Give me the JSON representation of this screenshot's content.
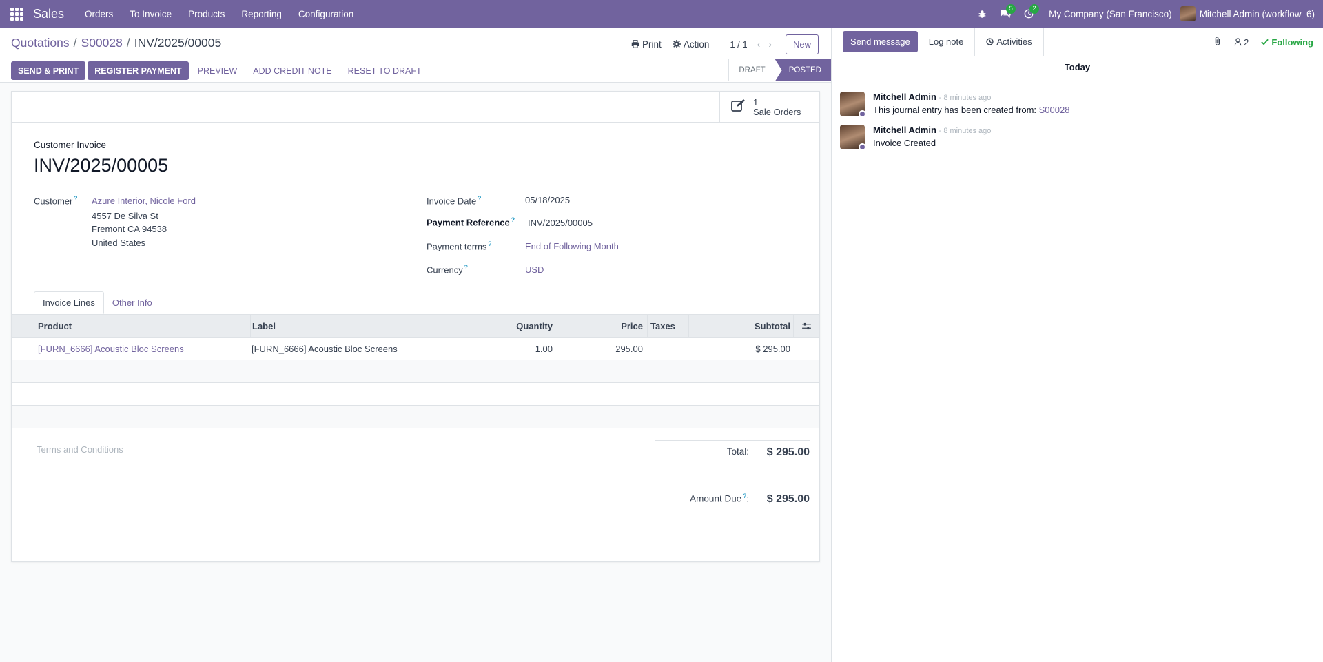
{
  "navbar": {
    "brand": "Sales",
    "menu": [
      "Orders",
      "To Invoice",
      "Products",
      "Reporting",
      "Configuration"
    ],
    "messages_badge": "5",
    "activities_badge": "2",
    "company": "My Company (San Francisco)",
    "user": "Mitchell Admin (workflow_6)"
  },
  "breadcrumb": {
    "items": [
      "Quotations",
      "S00028"
    ],
    "current": "INV/2025/00005"
  },
  "control": {
    "print_label": "Print",
    "action_label": "Action",
    "pager": "1 / 1",
    "new_label": "New"
  },
  "statusbar": {
    "send_print": "SEND & PRINT",
    "register_payment": "REGISTER PAYMENT",
    "preview": "PREVIEW",
    "add_credit_note": "ADD CREDIT NOTE",
    "reset_to_draft": "RESET TO DRAFT",
    "stage_draft": "DRAFT",
    "stage_posted": "POSTED"
  },
  "smart_button": {
    "count": "1",
    "label": "Sale Orders"
  },
  "invoice": {
    "type": "Customer Invoice",
    "number": "INV/2025/00005",
    "customer_label": "Customer",
    "customer_name": "Azure Interior, Nicole Ford",
    "address_line1": "4557 De Silva St",
    "address_line2": "Fremont CA 94538",
    "address_line3": "United States",
    "invoice_date_label": "Invoice Date",
    "invoice_date": "05/18/2025",
    "payment_reference_label": "Payment Reference",
    "payment_reference": "INV/2025/00005",
    "payment_terms_label": "Payment terms",
    "payment_terms": "End of Following Month",
    "currency_label": "Currency",
    "currency": "USD"
  },
  "tabs": [
    "Invoice Lines",
    "Other Info"
  ],
  "lines": {
    "headers": [
      "Product",
      "Label",
      "Quantity",
      "Price",
      "Taxes",
      "Subtotal"
    ],
    "rows": [
      {
        "product": "[FURN_6666] Acoustic Bloc Screens",
        "label": "[FURN_6666] Acoustic Bloc Screens",
        "quantity": "1.00",
        "price": "295.00",
        "taxes": "",
        "subtotal": "$ 295.00"
      }
    ]
  },
  "totals": {
    "terms_placeholder": "Terms and Conditions",
    "total_label": "Total:",
    "total_value": "$ 295.00",
    "amount_due_label": "Amount Due",
    "amount_due_colon": ":",
    "amount_due_value": "$ 295.00"
  },
  "chatter": {
    "send_message": "Send message",
    "log_note": "Log note",
    "activities": "Activities",
    "followers_count": "2",
    "following": "Following",
    "today": "Today",
    "messages": [
      {
        "author": "Mitchell Admin",
        "time": "- 8 minutes ago",
        "text": "This journal entry has been created from: ",
        "link": "S00028"
      },
      {
        "author": "Mitchell Admin",
        "time": "- 8 minutes ago",
        "text": "Invoice Created",
        "link": ""
      }
    ]
  },
  "colors": {
    "brand": "#71639e",
    "badge": "#28a745",
    "following": "#28a745"
  },
  "icons": [
    "apps-grid-icon",
    "bug-icon",
    "chat-icon",
    "clock-icon",
    "print-icon",
    "gear-icon",
    "chevron-left-icon",
    "chevron-right-icon",
    "edit-icon",
    "paperclip-icon",
    "user-icon",
    "check-icon",
    "sliders-icon"
  ]
}
